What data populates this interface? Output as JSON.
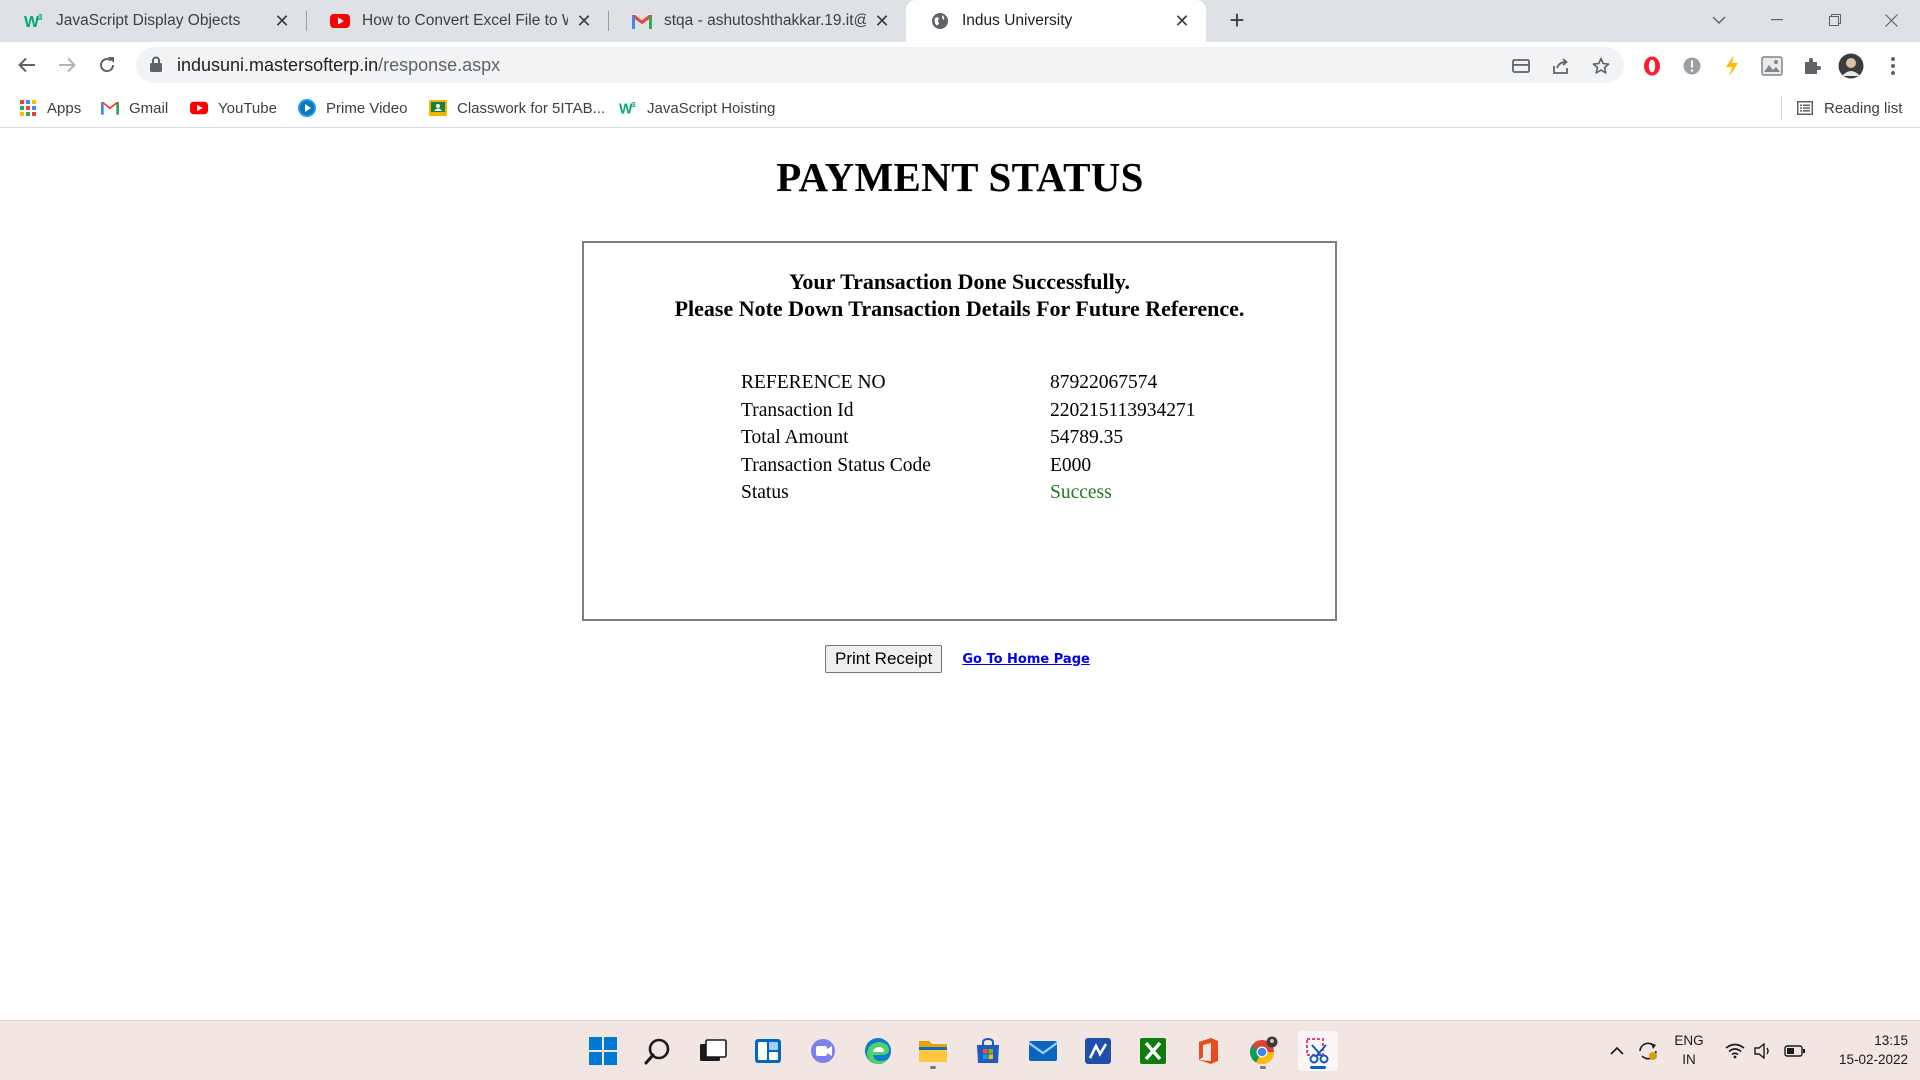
{
  "browser": {
    "tabs": [
      {
        "title": "JavaScript Display Objects",
        "icon": "w3schools-icon",
        "active": false
      },
      {
        "title": "How to Convert Excel File to Wor",
        "icon": "youtube-icon",
        "active": false
      },
      {
        "title": "stqa - ashutoshthakkar.19.it@iite",
        "icon": "gmail-icon",
        "active": false
      },
      {
        "title": "Indus University",
        "icon": "globe-icon",
        "active": true
      }
    ],
    "url_domain": "indusuni.mastersofterp.in",
    "url_path": "/response.aspx",
    "bookmarks": [
      {
        "label": "Apps",
        "icon": "apps-grid-icon"
      },
      {
        "label": "Gmail",
        "icon": "gmail-icon"
      },
      {
        "label": "YouTube",
        "icon": "youtube-icon"
      },
      {
        "label": "Prime Video",
        "icon": "prime-video-icon"
      },
      {
        "label": "Classwork for 5ITAB...",
        "icon": "classroom-icon"
      },
      {
        "label": "JavaScript Hoisting",
        "icon": "w3schools-icon"
      }
    ],
    "reading_list": "Reading list"
  },
  "page": {
    "heading": "PAYMENT STATUS",
    "message_line1": "Your Transaction Done Successfully.",
    "message_line2": "Please Note Down Transaction Details For Future Reference.",
    "details": [
      {
        "label": "REFERENCE NO",
        "value": "87922067574"
      },
      {
        "label": "Transaction Id",
        "value": "220215113934271"
      },
      {
        "label": "Total Amount",
        "value": "54789.35"
      },
      {
        "label": "Transaction Status Code",
        "value": "E000"
      },
      {
        "label": "Status",
        "value": "Success"
      }
    ],
    "print_button": "Print Receipt",
    "home_link": "Go To Home Page"
  },
  "taskbar": {
    "language_line1": "ENG",
    "language_line2": "IN",
    "time": "13:15",
    "date": "15-02-2022"
  },
  "colors": {
    "success": "#1f7a1f",
    "link": "#0000ee",
    "tab_strip": "#dee1e6",
    "taskbar": "#f2e6e3"
  }
}
